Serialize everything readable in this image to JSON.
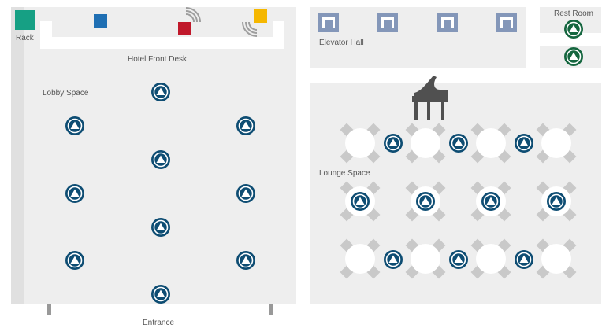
{
  "labels": {
    "rack": "Rack",
    "front_desk": "Hotel Front Desk",
    "lobby": "Lobby Space",
    "elevator_hall": "Elevator Hall",
    "rest_room": "Rest Room",
    "lounge": "Lounge Space",
    "entrance": "Entrance"
  },
  "colors": {
    "floor": "#eeeeee",
    "wall": "#e0e0e0",
    "ap_blue": "#0e4d73",
    "ap_green": "#15663f",
    "rack": "#16a084",
    "device_blue": "#1f6fb3",
    "device_red": "#c0182a",
    "device_yellow": "#f5b700",
    "elevator": "#8497b9",
    "chair": "#c9c9c9",
    "table": "#ffffff",
    "piano": "#505050"
  },
  "icons": {
    "access_point": "access-point-icon",
    "wireless_sensor": "wireless-signal-icon",
    "elevator": "elevator-icon",
    "piano": "grand-piano-icon",
    "rack": "rack-icon"
  }
}
